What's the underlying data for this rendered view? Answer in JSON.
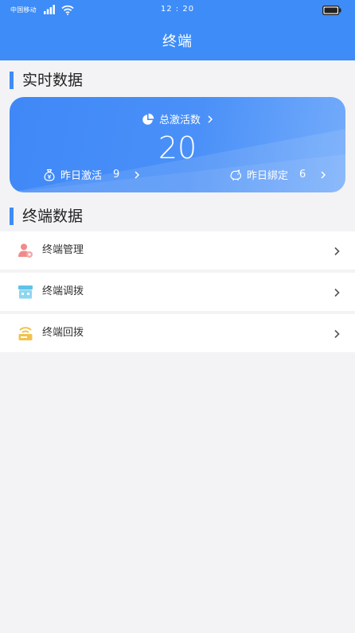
{
  "status_bar": {
    "carrier": "中国移动",
    "time": "12 : 20"
  },
  "nav": {
    "title": "终端"
  },
  "realtime": {
    "section_title": "实时数据",
    "total_label": "总激活数",
    "total_value": "20",
    "yesterday_activated_label": "昨日激活",
    "yesterday_activated_value": "9",
    "yesterday_bound_label": "昨日綁定",
    "yesterday_bound_value": "6"
  },
  "terminal": {
    "section_title": "终端数据",
    "items": [
      {
        "label": "终端管理",
        "icon": "user-gear-icon",
        "color": "#f08a8a"
      },
      {
        "label": "终端调拨",
        "icon": "store-icon",
        "color": "#5ec3e8"
      },
      {
        "label": "终端回拨",
        "icon": "wifi-device-icon",
        "color": "#f2c14e"
      }
    ]
  },
  "colors": {
    "primary": "#3d8cf8",
    "background": "#f3f3f5"
  }
}
